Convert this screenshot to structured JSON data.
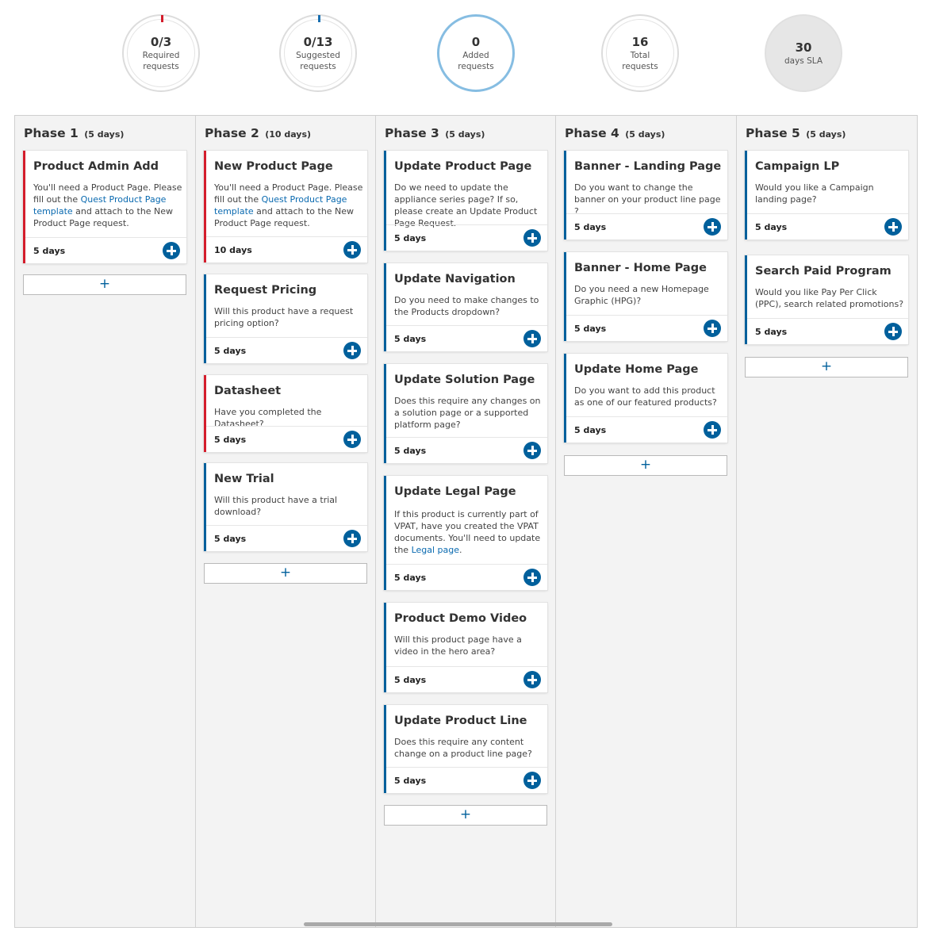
{
  "stats": [
    {
      "value": "0/3",
      "label": "Required requests",
      "tick": "#d41d2c"
    },
    {
      "value": "0/13",
      "label": "Suggested requests",
      "tick": "#1a6fb0"
    },
    {
      "value": "0",
      "label": "Added requests"
    },
    {
      "value": "16",
      "label": "Total requests"
    },
    {
      "value": "30",
      "label": "days SLA"
    }
  ],
  "colors": {
    "required": "#d41d2c",
    "optional": "#00609c",
    "link": "#0a6ab0",
    "accent": "#86bde2"
  },
  "phases": [
    {
      "title": "Phase 1",
      "duration": "(5 days)",
      "add_label": "+",
      "cards": [
        {
          "title": "Product Admin Add",
          "desc_pre": "You'll need a Product Page. Please fill out the ",
          "link": "Quest Product Page template",
          "desc_post": " and attach to the New Product Page request.",
          "days": "5 days",
          "required": true
        }
      ]
    },
    {
      "title": "Phase 2",
      "duration": "(10 days)",
      "add_label": "+",
      "cards": [
        {
          "title": "New Product Page",
          "desc_pre": "You'll need a Product Page. Please fill out the ",
          "link": "Quest Product Page template",
          "desc_post": " and attach to the New Product Page request.",
          "days": "10 days",
          "required": true
        },
        {
          "title": "Request Pricing",
          "desc_pre": "Will this product have a request pricing option?",
          "days": "5 days",
          "required": false
        },
        {
          "title": "Datasheet",
          "desc_pre": "Have you completed the Datasheet?",
          "days": "5 days",
          "required": true
        },
        {
          "title": "New Trial",
          "desc_pre": "Will this product have a trial download?",
          "days": "5 days",
          "required": false
        }
      ]
    },
    {
      "title": "Phase 3",
      "duration": "(5 days)",
      "add_label": "+",
      "cards": [
        {
          "title": "Update Product Page",
          "desc_pre": "Do we need to update the appliance series page? If so, please create an Update Product Page Request.",
          "days": "5 days",
          "required": false
        },
        {
          "title": "Update Navigation",
          "desc_pre": "Do you need to make changes to the Products dropdown?",
          "days": "5 days",
          "required": false
        },
        {
          "title": "Update Solution Page",
          "desc_pre": "Does this require any changes on a solution page or a supported platform page?",
          "days": "5 days",
          "required": false
        },
        {
          "title": "Update Legal Page",
          "desc_pre": "If this product is currently part of VPAT, have you created the VPAT documents. You'll need to update the ",
          "link": "Legal page",
          "desc_post": ".",
          "days": "5 days",
          "required": false
        },
        {
          "title": "Product Demo Video",
          "desc_pre": "Will this product page have a video in the hero area?",
          "days": "5 days",
          "required": false
        },
        {
          "title": "Update Product Line",
          "desc_pre": "Does this require any content change on a product line page?",
          "days": "5 days",
          "required": false
        }
      ]
    },
    {
      "title": "Phase 4",
      "duration": "(5 days)",
      "add_label": "+",
      "cards": [
        {
          "title": "Banner - Landing Page",
          "desc_pre": "Do you want to change the banner on your product line page ?",
          "days": "5 days",
          "required": false
        },
        {
          "title": "Banner - Home Page",
          "desc_pre": "Do you need a new Homepage Graphic (HPG)?",
          "days": "5 days",
          "required": false
        },
        {
          "title": "Update Home Page",
          "desc_pre": "Do you want to add this product as one of our featured products?",
          "days": "5 days",
          "required": false
        }
      ]
    },
    {
      "title": "Phase 5",
      "duration": "(5 days)",
      "add_label": "+",
      "cards": [
        {
          "title": "Campaign LP",
          "desc_pre": "Would you like a Campaign landing page?",
          "days": "5 days",
          "required": false
        },
        {
          "title": "Search Paid Program",
          "desc_pre": "Would you like Pay Per Click (PPC), search related promotions?",
          "days": "5 days",
          "required": false
        }
      ]
    }
  ]
}
